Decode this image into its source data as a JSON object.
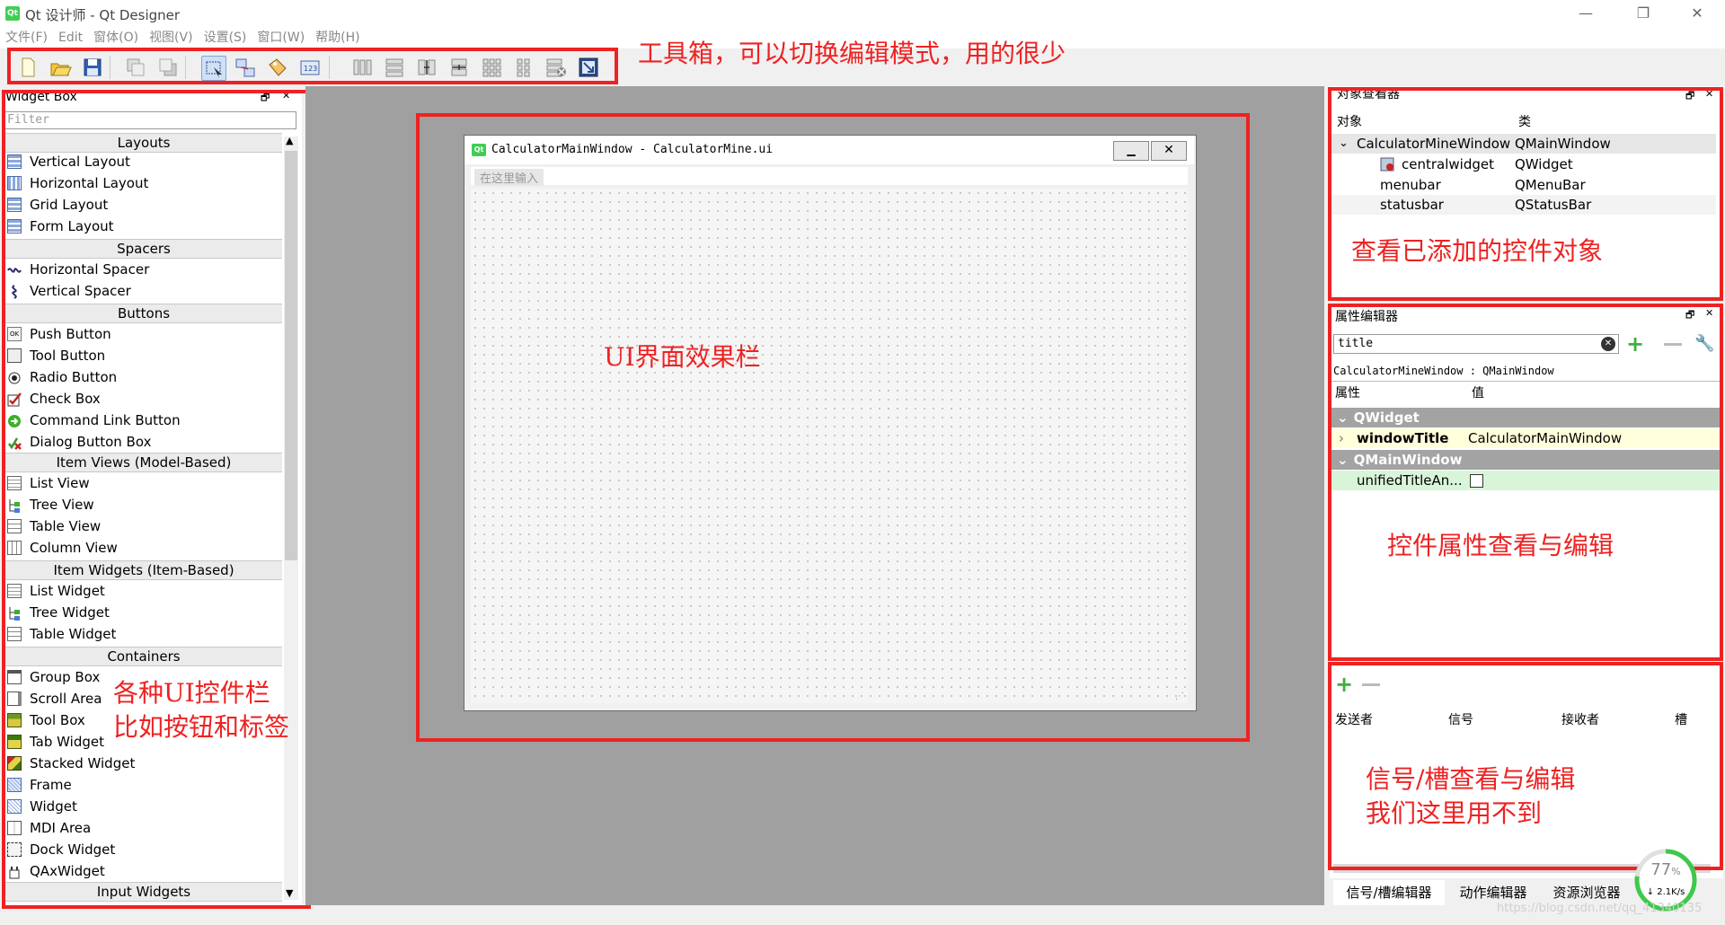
{
  "window": {
    "title": "Qt 设计师 - Qt Designer",
    "logo": "Qt",
    "controls": [
      "—",
      "❐",
      "✕"
    ]
  },
  "menubar": {
    "items": [
      "文件(F)",
      "Edit",
      "窗体(O)",
      "视图(V)",
      "设置(S)",
      "窗口(W)",
      "帮助(H)"
    ]
  },
  "annotations": {
    "toolbar": "工具箱，可以切换编辑模式，用的很少",
    "widgetbox_line1": "各种UI控件栏",
    "widgetbox_line2": "比如按钮和标签",
    "central": "UI界面效果栏",
    "object_inspector": "查看已添加的控件对象",
    "property_editor": "控件属性查看与编辑",
    "signal_slot_line1": "信号/槽查看与编辑",
    "signal_slot_line2": "我们这里用不到"
  },
  "widget_box": {
    "title": "Widget Box",
    "filter_placeholder": "Filter",
    "categories": {
      "layouts": "Layouts",
      "spacers": "Spacers",
      "buttons": "Buttons",
      "item_views": "Item Views (Model-Based)",
      "item_widgets": "Item Widgets (Item-Based)",
      "containers": "Containers",
      "input_widgets": "Input Widgets"
    },
    "items": {
      "vertical_layout": "Vertical Layout",
      "horizontal_layout": "Horizontal Layout",
      "grid_layout": "Grid Layout",
      "form_layout": "Form Layout",
      "horizontal_spacer": "Horizontal Spacer",
      "vertical_spacer": "Vertical Spacer",
      "push_button": "Push Button",
      "tool_button": "Tool Button",
      "radio_button": "Radio Button",
      "check_box": "Check Box",
      "command_link_button": "Command Link Button",
      "dialog_button_box": "Dialog Button Box",
      "list_view": "List View",
      "tree_view": "Tree View",
      "table_view": "Table View",
      "column_view": "Column View",
      "list_widget": "List Widget",
      "tree_widget": "Tree Widget",
      "table_widget": "Table Widget",
      "group_box": "Group Box",
      "scroll_area": "Scroll Area",
      "tool_box": "Tool Box",
      "tab_widget": "Tab Widget",
      "stacked_widget": "Stacked Widget",
      "frame": "Frame",
      "widget": "Widget",
      "mdi_area": "MDI Area",
      "dock_widget": "Dock Widget",
      "qaxwidget": "QAxWidget"
    }
  },
  "form": {
    "title": "CalculatorMainWindow - CalculatorMine.ui",
    "logo": "Qt",
    "menu_placeholder": "在这里输入"
  },
  "object_inspector": {
    "title": "对象查看器",
    "col_object": "对象",
    "col_class": "类",
    "rows": [
      {
        "name": "CalculatorMineWindow",
        "cls": "QMainWindow"
      },
      {
        "name": "centralwidget",
        "cls": "QWidget"
      },
      {
        "name": "menubar",
        "cls": "QMenuBar"
      },
      {
        "name": "statusbar",
        "cls": "QStatusBar"
      }
    ]
  },
  "property_editor": {
    "title": "属性编辑器",
    "filter_value": "title",
    "context": "CalculatorMineWindow : QMainWindow",
    "col_property": "属性",
    "col_value": "值",
    "group_qwidget": "QWidget",
    "prop_window_title": "windowTitle",
    "prop_window_title_value": "CalculatorMainWindow",
    "group_qmainwindow": "QMainWindow",
    "prop_unified": "unifiedTitleAn..."
  },
  "signal_slot": {
    "col_sender": "发送者",
    "col_signal": "信号",
    "col_receiver": "接收者",
    "col_slot": "槽"
  },
  "bottom_tabs": [
    "信号/槽编辑器",
    "动作编辑器",
    "资源浏览器"
  ],
  "net_widget": {
    "percent": "77",
    "percent_sign": "%",
    "speed": "↓ 2.1K/s",
    "level": 0.77
  },
  "watermark": "https://blog.csdn.net/qq_41340135",
  "colors": {
    "annotation_red": "#ee2222",
    "group_grey": "#a3a3a3",
    "highlight_yellow": "#ffffdc",
    "highlight_green": "#d9f5d9",
    "mdi_grey": "#a0a0a0"
  }
}
